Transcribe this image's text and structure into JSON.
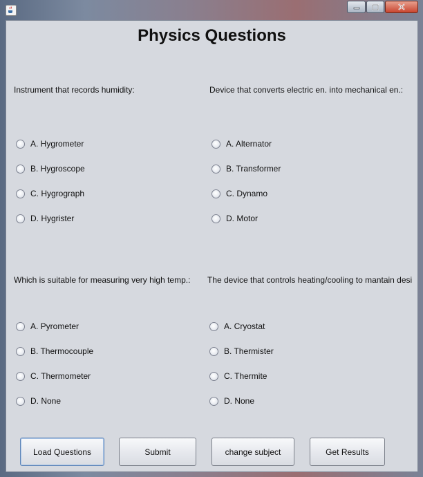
{
  "page": {
    "title": "Physics Questions",
    "questions": [
      {
        "text": "Instrument that records humidity:",
        "options": [
          "A. Hygrometer",
          "B. Hygroscope",
          "C. Hygrograph",
          "D. Hygrister"
        ]
      },
      {
        "text": "Device that converts electric en. into mechanical en.:",
        "options": [
          "A. Alternator",
          "B. Transformer",
          "C. Dynamo",
          "D. Motor"
        ]
      },
      {
        "text": "Which is suitable for measuring very high temp.:",
        "options": [
          "A. Pyrometer",
          "B. Thermocouple",
          "C. Thermometer",
          "D. None"
        ]
      },
      {
        "text": "The device that controls heating/cooling to mantain desi",
        "options": [
          "A. Cryostat",
          "B. Thermister",
          "C. Thermite",
          "D. None"
        ]
      }
    ]
  },
  "buttons": {
    "load": "Load Questions",
    "submit": "Submit",
    "change": "change subject",
    "results": "Get Results"
  }
}
